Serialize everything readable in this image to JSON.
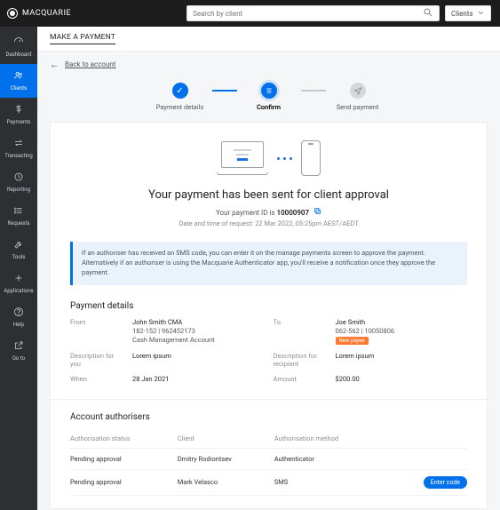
{
  "brand": "MACQUARIE",
  "search": {
    "placeholder": "Search by client",
    "scope": "Clients"
  },
  "sidebar": {
    "items": [
      {
        "label": "Dashboard"
      },
      {
        "label": "Clients"
      },
      {
        "label": "Payments"
      },
      {
        "label": "Transacting"
      },
      {
        "label": "Reporting"
      },
      {
        "label": "Requests"
      },
      {
        "label": "Tools"
      },
      {
        "label": "Applications"
      },
      {
        "label": "Help"
      },
      {
        "label": "Go to"
      }
    ]
  },
  "page": {
    "title": "MAKE A PAYMENT",
    "back": "Back to account"
  },
  "stepper": [
    {
      "label": "Payment details"
    },
    {
      "label": "Confirm"
    },
    {
      "label": "Send payment"
    }
  ],
  "confirm": {
    "headline": "Your payment has been sent for client approval",
    "payment_id_label": "Your payment ID is ",
    "payment_id": "10000907",
    "timestamp": "Date and time of request: 22 Mar 2022, 05:25pm AEST/AEDT",
    "info": "If an authoriser has received an SMS code, you can enter it on the manage payments screen to approve the payment. Alternatively if an authoriser is using the Macquarie Authenticator app, you'll receive a notification once they approve the payment."
  },
  "details": {
    "title": "Payment details",
    "labels": {
      "from": "From",
      "to": "To",
      "desc_you": "Description for you",
      "desc_rec": "Description for recipient",
      "when": "When",
      "amount": "Amount"
    },
    "from": {
      "name": "John Smith CMA",
      "account": "182-152 | 962452173",
      "type": "Cash Management Account"
    },
    "to": {
      "name": "Joe Smith",
      "account": "062-562 | 10050806",
      "badge": "New payee"
    },
    "desc_you": "Lorem ipsum",
    "desc_rec": "Lorem ipsum",
    "when": "28 Jan 2021",
    "amount": "$200.00"
  },
  "authorisers": {
    "title": "Account authorisers",
    "cols": {
      "status": "Authorisation status",
      "client": "Client",
      "method": "Authorisation method"
    },
    "rows": [
      {
        "status": "Pending approval",
        "client": "Dmitry Rodiontsev",
        "method": "Authenticator",
        "action": ""
      },
      {
        "status": "Pending approval",
        "client": "Mark Velasco",
        "method": "SMS",
        "action": "Enter code"
      }
    ]
  }
}
